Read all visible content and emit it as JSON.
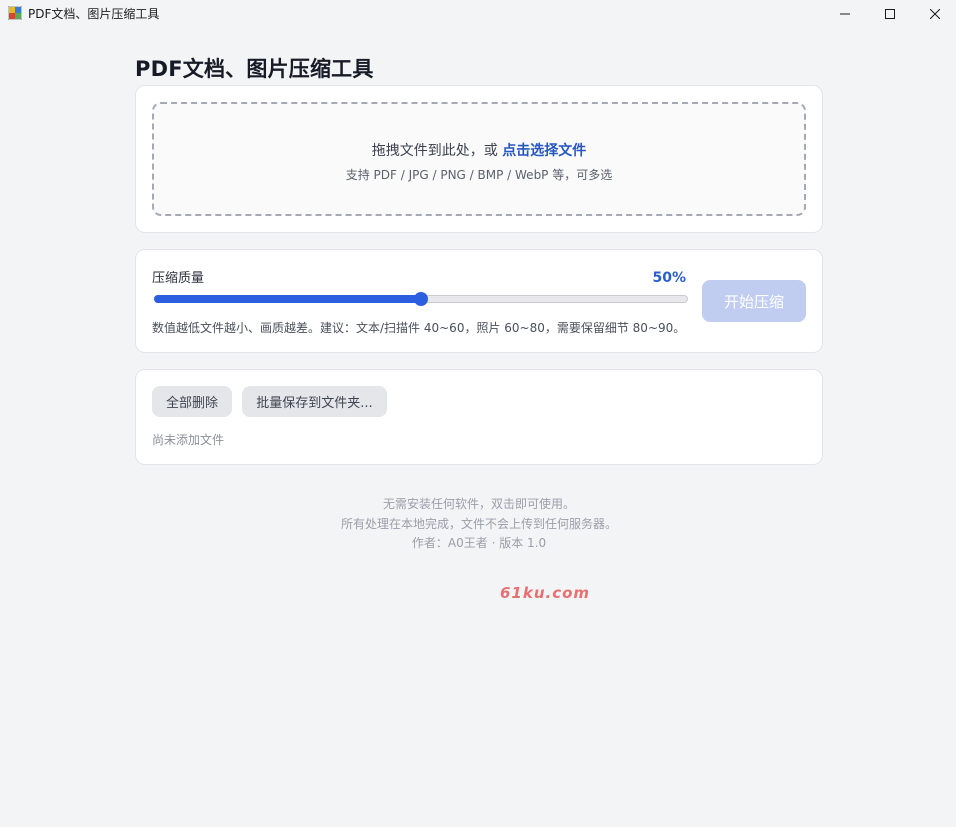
{
  "window": {
    "title": "PDF文档、图片压缩工具"
  },
  "page": {
    "title": "PDF文档、图片压缩工具"
  },
  "dropzone": {
    "prompt": "拖拽文件到此处，或 ",
    "link": "点击选择文件",
    "formats": "支持 PDF / JPG / PNG / BMP / WebP 等，可多选"
  },
  "quality": {
    "label": "压缩质量",
    "value": 50,
    "value_display": "50%",
    "hint": "数值越低文件越小、画质越差。建议：文本/扫描件 40~60，照片 60~80，需要保留细节 80~90。",
    "start_label": "开始压缩"
  },
  "files": {
    "delete_all_label": "全部删除",
    "batch_save_label": "批量保存到文件夹...",
    "empty_text": "尚未添加文件"
  },
  "footer": {
    "line1": "无需安装任何软件，双击即可使用。",
    "line2": "所有处理在本地完成，文件不会上传到任何服务器。",
    "line3": "作者：A0王者  ·  版本 1.0"
  },
  "watermark": "61ku.com",
  "colors": {
    "accent": "#2b5fe0",
    "link": "#2556c4",
    "start_button_disabled": "#c1cdf0",
    "background": "#f3f4f6"
  }
}
